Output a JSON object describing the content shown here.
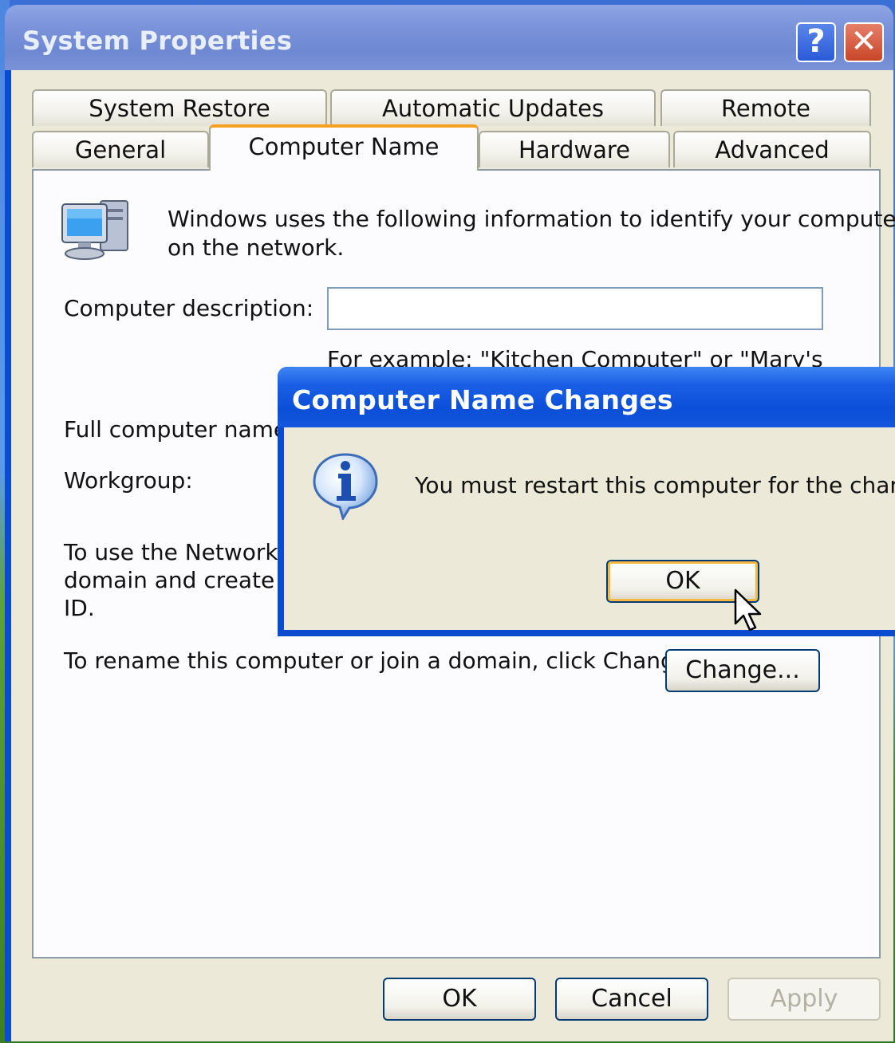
{
  "window": {
    "title": "System Properties",
    "help_button": "?",
    "close_button": "✕"
  },
  "tabs": {
    "row1": [
      "System Restore",
      "Automatic Updates",
      "Remote"
    ],
    "row2": [
      "General",
      "Computer Name",
      "Hardware",
      "Advanced"
    ],
    "active": "Computer Name"
  },
  "computer_name_tab": {
    "intro_line1": "Windows uses the following information to identify your computer",
    "intro_line2": "on the network.",
    "description_label": "Computer description:",
    "description_value": "",
    "example_text": "For example: \"Kitchen Computer\" or \"Mary's",
    "full_name_label": "Full computer name:",
    "workgroup_label": "Workgroup:",
    "network_id_line1": "To use the Network Ic",
    "network_id_line2": "domain and create a l",
    "network_id_line3": "ID.",
    "rename_text": "To rename this computer or join a domain, click Change.",
    "change_button": "Change..."
  },
  "footer": {
    "ok": "OK",
    "cancel": "Cancel",
    "apply": "Apply"
  },
  "message_box": {
    "title": "Computer Name Changes",
    "message": "You must restart this computer for the changes",
    "ok": "OK",
    "icon": "information-icon"
  },
  "colors": {
    "xp_blue": "#0a4bd0",
    "dialog_face": "#ece9d8",
    "focus_orange": "#f5b841"
  }
}
